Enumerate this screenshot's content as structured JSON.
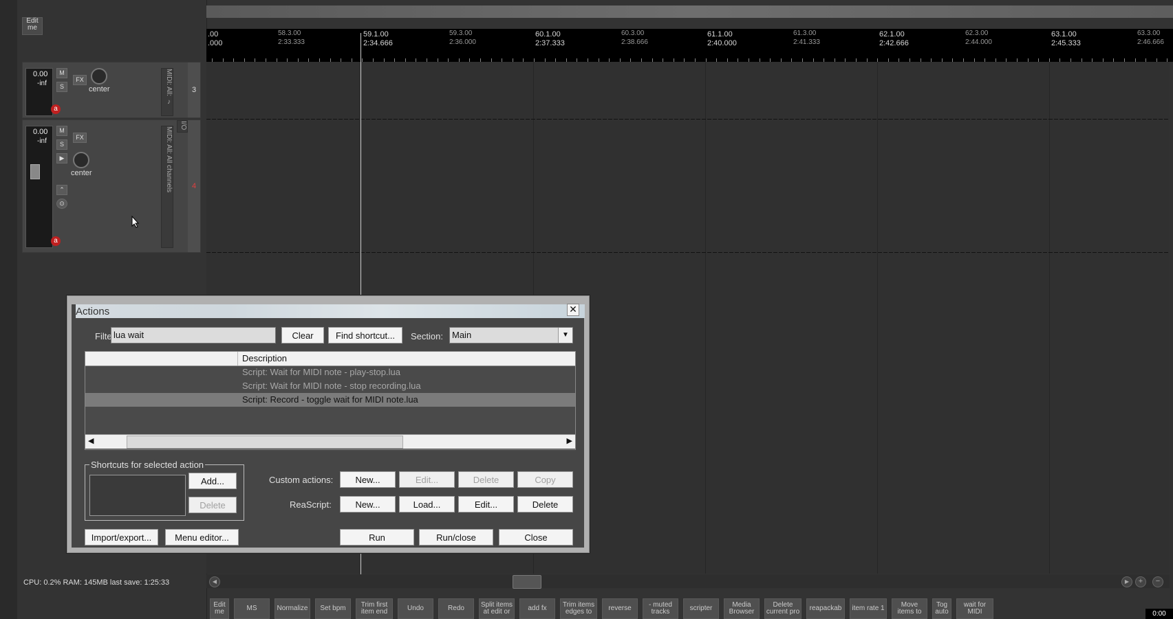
{
  "track_panel": {
    "edit_button": "Edit me",
    "tracks": [
      {
        "volume": "0.00",
        "level": "-inf",
        "mute": "M",
        "solo": "S",
        "fx": "FX",
        "pan": "center",
        "routing": "MIDI: All: ♪",
        "number": "3",
        "rec": "a"
      },
      {
        "volume": "0.00",
        "level": "-inf",
        "mute": "M",
        "solo": "S",
        "fx": "FX",
        "pan": "center",
        "routing": "MIDI: All: All channels",
        "number": "4",
        "io": "I/O",
        "rec": "a"
      }
    ]
  },
  "ruler": {
    "markers": [
      {
        "bar": ".00",
        "time": ".000",
        "major": true
      },
      {
        "bar": "58.3.00",
        "time": "2:33.333",
        "major": false
      },
      {
        "bar": "59.1.00",
        "time": "2:34.666",
        "major": true
      },
      {
        "bar": "59.3.00",
        "time": "2:36.000",
        "major": false
      },
      {
        "bar": "60.1.00",
        "time": "2:37.333",
        "major": true
      },
      {
        "bar": "60.3.00",
        "time": "2:38.666",
        "major": false
      },
      {
        "bar": "61.1.00",
        "time": "2:40.000",
        "major": true
      },
      {
        "bar": "61.3.00",
        "time": "2:41.333",
        "major": false
      },
      {
        "bar": "62.1.00",
        "time": "2:42.666",
        "major": true
      },
      {
        "bar": "62.3.00",
        "time": "2:44.000",
        "major": false
      },
      {
        "bar": "63.1.00",
        "time": "2:45.333",
        "major": true
      },
      {
        "bar": "63.3.00",
        "time": "2:46.666",
        "major": false
      }
    ]
  },
  "status_bar": "CPU: 0.2%  RAM: 145MB  last save: 1:25:33",
  "toolbar": [
    "Edit me",
    "MS",
    "Normalize",
    "Set bpm",
    "Trim first item end",
    "Undo",
    "Redo",
    "Split items at edit or",
    "add fx",
    "Trim items edges to",
    "reverse",
    "- muted tracks",
    "scripter",
    "Media Browser",
    "Delete current pro",
    "reapackab",
    "item rate 1",
    "Move items to",
    "Tog auto",
    "wait for MIDI"
  ],
  "time_display": "0:00",
  "dialog": {
    "title": "Actions",
    "filter_label": "Filter:",
    "filter_value": "lua wait",
    "clear": "Clear",
    "find_shortcut": "Find shortcut...",
    "section_label": "Section:",
    "section_value": "Main",
    "columns": [
      "",
      "Description"
    ],
    "rows": [
      {
        "description": "Script: Wait for MIDI note - play-stop.lua",
        "selected": false
      },
      {
        "description": "Script: Wait for MIDI note - stop recording.lua",
        "selected": false
      },
      {
        "description": "Script: Record - toggle wait for MIDI note.lua",
        "selected": true
      }
    ],
    "shortcuts_group": "Shortcuts for selected action",
    "add": "Add...",
    "delete_shortcut": "Delete",
    "custom_actions_label": "Custom actions:",
    "custom_new": "New...",
    "custom_edit": "Edit...",
    "custom_delete": "Delete",
    "custom_copy": "Copy",
    "reascript_label": "ReaScript:",
    "rs_new": "New...",
    "rs_load": "Load...",
    "rs_edit": "Edit...",
    "rs_delete": "Delete",
    "import_export": "Import/export...",
    "menu_editor": "Menu editor...",
    "run": "Run",
    "run_close": "Run/close",
    "close": "Close"
  }
}
